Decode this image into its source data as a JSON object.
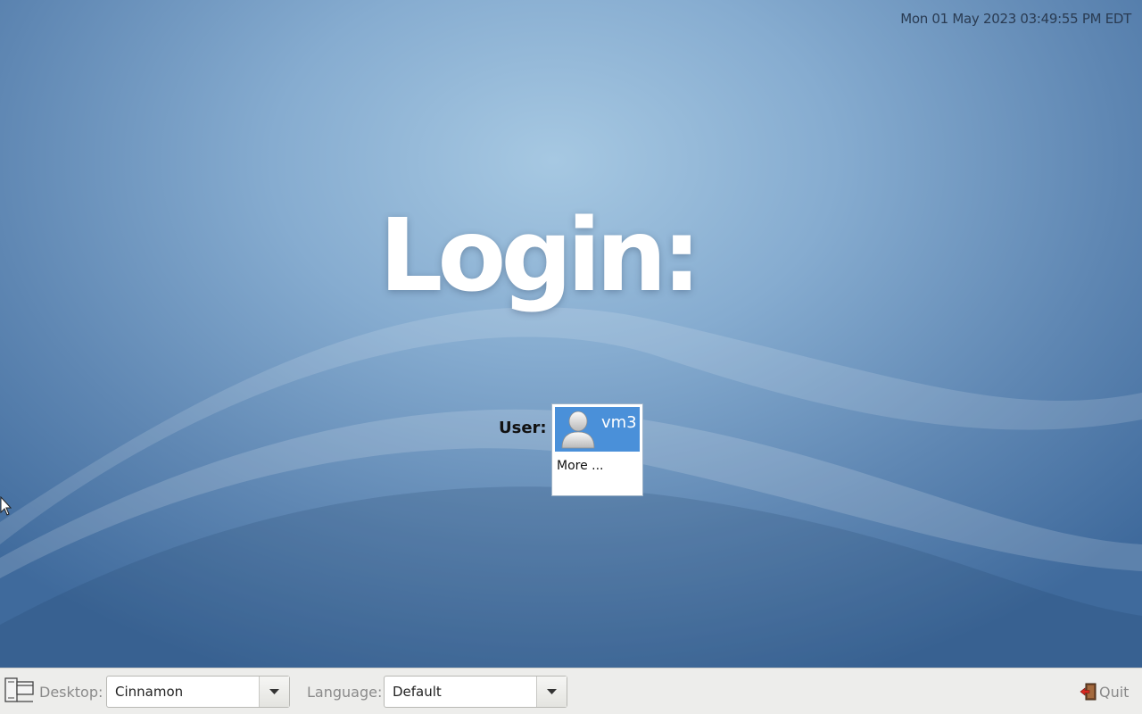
{
  "clock": {
    "text": "Mon 01 May 2023 03:49:55 PM EDT"
  },
  "login": {
    "title": "Login:"
  },
  "users": {
    "label": "User:",
    "items": [
      {
        "name": "vm3",
        "selected": true
      }
    ],
    "more_label": "More ..."
  },
  "bottom_bar": {
    "desktop_label": "Desktop:",
    "desktop_value": "Cinnamon",
    "language_label": "Language:",
    "language_value": "Default",
    "quit_label": "Quit"
  },
  "icons": {
    "session": "session-windows-icon",
    "quit": "exit-door-icon",
    "avatar": "user-silhouette-icon",
    "dropdown": "triangle-down-icon",
    "cursor": "mouse-pointer-icon"
  },
  "colors": {
    "selection": "#4a90d9",
    "bar_background": "#ededeb",
    "background_center": "#a6c8e2",
    "background_edge": "#3f6a9c"
  }
}
